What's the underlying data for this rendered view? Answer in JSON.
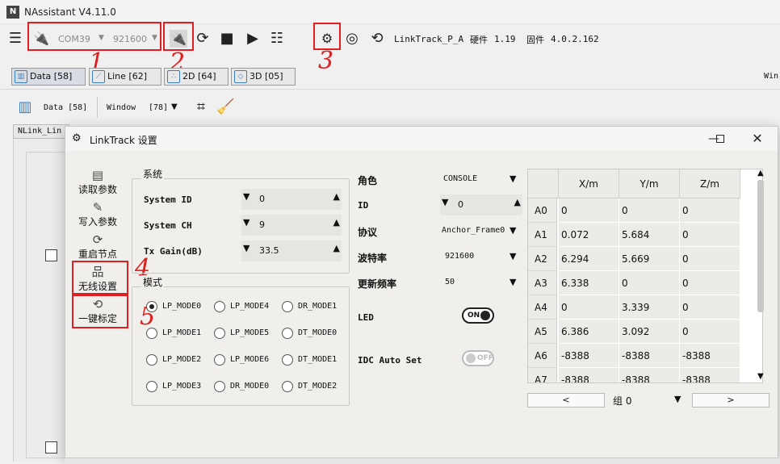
{
  "app": {
    "title": "NAssistant V4.11.0",
    "logo": "N"
  },
  "toolbar": {
    "port": "COM39",
    "baud": "921600",
    "device": "LinkTrack_P_A",
    "hardware_label": "硬件",
    "hardware": "1.19",
    "firmware_label": "固件",
    "firmware": "4.0.2.162"
  },
  "annotations": {
    "n1": "1",
    "n2": "2",
    "n3": "3",
    "n4": "4",
    "n5": "5",
    "color": "#e02020"
  },
  "tabs": [
    {
      "label": "Data [58]"
    },
    {
      "label": "Line [62]"
    },
    {
      "label": "2D [64]"
    },
    {
      "label": "3D [05]"
    }
  ],
  "tab_overflow": "Win",
  "subbar": {
    "data_label": "Data [58]",
    "window_label": "Window",
    "window_value": "[78]"
  },
  "bg_panel_tab": "NLink_Lin",
  "dialog": {
    "title": "LinkTrack 设置",
    "side": {
      "read": "读取参数",
      "write": "写入参数",
      "restart": "重启节点",
      "wireless": "无线设置",
      "calib": "一键标定"
    },
    "system": {
      "group_title": "系统",
      "system_id_label": "System ID",
      "system_id": "0",
      "system_ch_label": "System CH",
      "system_ch": "9",
      "tx_gain_label": "Tx Gain(dB)",
      "tx_gain": "33.5"
    },
    "mode": {
      "group_title": "模式",
      "options": [
        "LP_MODE0",
        "LP_MODE1",
        "LP_MODE2",
        "LP_MODE3",
        "LP_MODE4",
        "LP_MODE5",
        "LP_MODE6",
        "DR_MODE0",
        "DR_MODE1",
        "DT_MODE0",
        "DT_MODE1",
        "DT_MODE2"
      ],
      "selected": "LP_MODE0"
    },
    "settings": {
      "role_label": "角色",
      "role": "CONSOLE",
      "id_label": "ID",
      "id": "0",
      "protocol_label": "协议",
      "protocol": "Anchor_Frame0",
      "baud_label": "波特率",
      "baud": "921600",
      "rate_label": "更新频率",
      "rate": "50",
      "led_label": "LED",
      "led": "ON",
      "idc_label": "IDC Auto Set",
      "idc": "OFF"
    },
    "table": {
      "columns": [
        "X/m",
        "Y/m",
        "Z/m"
      ],
      "rows": [
        {
          "name": "A0",
          "x": "0",
          "y": "0",
          "z": "0"
        },
        {
          "name": "A1",
          "x": "0.072",
          "y": "5.684",
          "z": "0"
        },
        {
          "name": "A2",
          "x": "6.294",
          "y": "5.669",
          "z": "0"
        },
        {
          "name": "A3",
          "x": "6.338",
          "y": "0",
          "z": "0"
        },
        {
          "name": "A4",
          "x": "0",
          "y": "3.339",
          "z": "0"
        },
        {
          "name": "A5",
          "x": "6.386",
          "y": "3.092",
          "z": "0"
        },
        {
          "name": "A6",
          "x": "-8388",
          "y": "-8388",
          "z": "-8388"
        },
        {
          "name": "A7",
          "x": "-8388",
          "y": "-8388",
          "z": "-8388"
        }
      ]
    },
    "pager": {
      "prev": "<",
      "group": "组 0",
      "next": ">"
    }
  }
}
